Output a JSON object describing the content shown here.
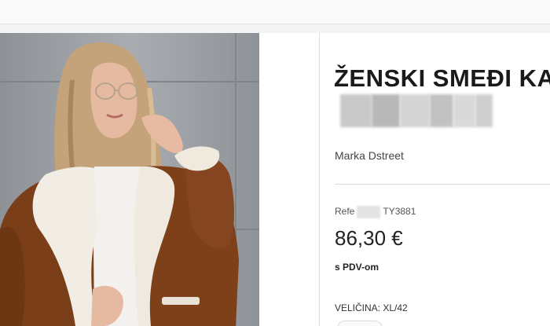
{
  "product": {
    "title": "ŽENSKI SMEĐI KAPU",
    "brand_label": "Marka Dstreet",
    "reference_prefix": "Refe",
    "reference_suffix": "TY3881",
    "price": "86,30 €",
    "vat_note": "s PDV-om",
    "size_label": "VELIČINA: XL/42"
  },
  "colors": {
    "coat": "#7a3f18",
    "fur": "#f1ece4",
    "background_wall": "#9a9fa3",
    "text": "#1a1a1a"
  }
}
